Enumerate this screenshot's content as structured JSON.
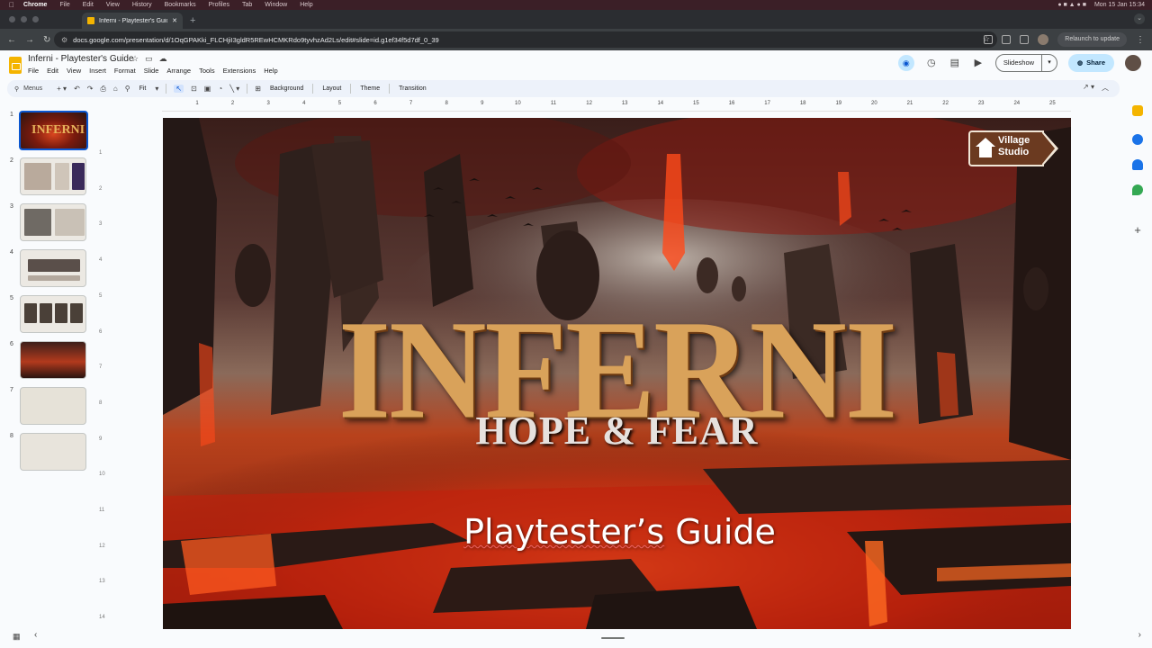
{
  "macos_menu": {
    "items": [
      "Chrome",
      "File",
      "Edit",
      "View",
      "History",
      "Bookmarks",
      "Profiles",
      "Tab",
      "Window",
      "Help"
    ],
    "clock": "Mon 15 Jan  15:34"
  },
  "browser": {
    "tab_title": "Inferni - Playtester's Guide -",
    "url": "docs.google.com/presentation/d/1OqGPAKki_FLCHjiI3gldR5REwHCMKRdo9tyvhzAd2Ls/edit#slide=id.g1ef34f5d7df_0_39",
    "relaunch_label": "Relaunch to update"
  },
  "docs": {
    "title": "Inferni - Playtester's Guide",
    "menu": [
      "File",
      "Edit",
      "View",
      "Insert",
      "Format",
      "Slide",
      "Arrange",
      "Tools",
      "Extensions",
      "Help"
    ],
    "slideshow_label": "Slideshow",
    "share_label": "Share"
  },
  "toolbar": {
    "search_label": "Menus",
    "zoom_label": "Fit",
    "background_label": "Background",
    "layout_label": "Layout",
    "theme_label": "Theme",
    "transition_label": "Transition"
  },
  "filmstrip": {
    "numbers": [
      "1",
      "2",
      "3",
      "4",
      "5",
      "6",
      "7",
      "8"
    ],
    "active_index": 1,
    "thumb1_title": "INFERNI"
  },
  "ruler": {
    "top": [
      "1",
      "2",
      "3",
      "4",
      "5",
      "6",
      "7",
      "8",
      "9",
      "10",
      "11",
      "12",
      "13",
      "14",
      "15",
      "16",
      "17",
      "18",
      "19",
      "20",
      "21",
      "22",
      "23",
      "24",
      "25"
    ],
    "left": [
      "1",
      "2",
      "3",
      "4",
      "5",
      "6",
      "7",
      "8",
      "9",
      "10",
      "11",
      "12",
      "13",
      "14"
    ]
  },
  "slide": {
    "logo_line1": "Village",
    "logo_line2": "Studio",
    "title": "INFERNI",
    "subtitle_top": "HOPE & FEAR",
    "caption_word1": "Playtester’s",
    "caption_word2": "Guide"
  },
  "colors": {
    "accent_blue": "#0b57d0",
    "share_bg": "#c2e7ff",
    "lava": "#d9461f",
    "title_gold": "#d9a25a"
  }
}
